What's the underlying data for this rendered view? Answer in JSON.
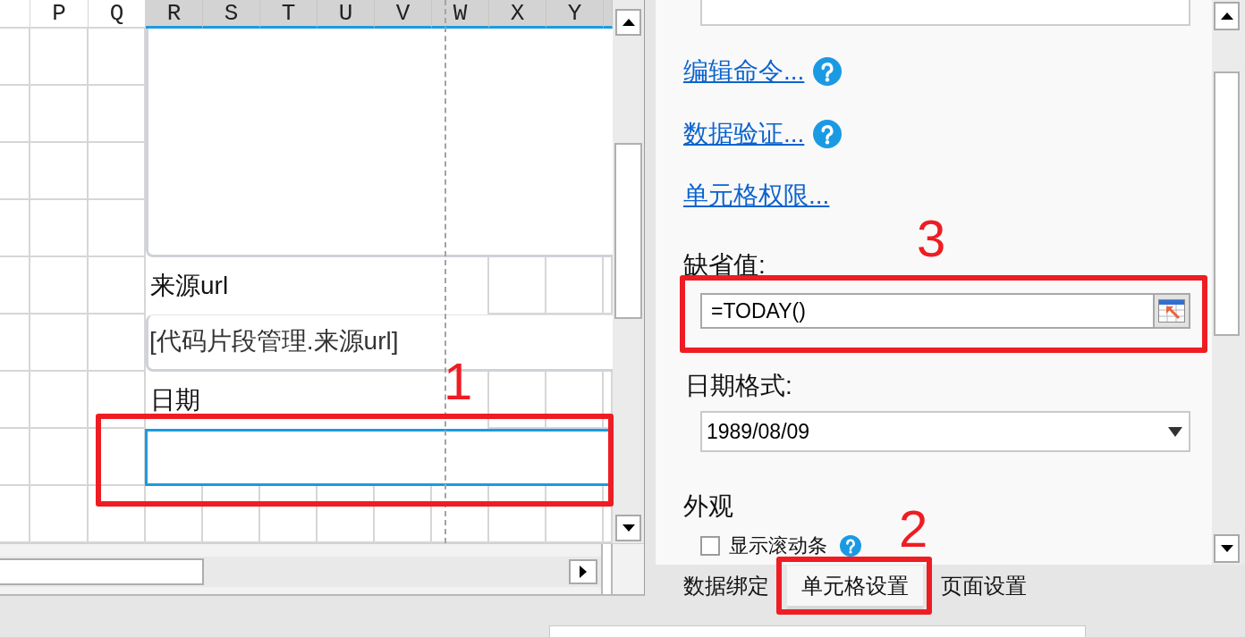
{
  "sheet": {
    "column_headers": [
      {
        "label": "P",
        "selected": false
      },
      {
        "label": "Q",
        "selected": false
      },
      {
        "label": "R",
        "selected": true
      },
      {
        "label": "S",
        "selected": true
      },
      {
        "label": "T",
        "selected": true
      },
      {
        "label": "U",
        "selected": true
      },
      {
        "label": "V",
        "selected": true
      },
      {
        "label": "W",
        "selected": true
      },
      {
        "label": "X",
        "selected": true
      },
      {
        "label": "Y",
        "selected": true
      }
    ],
    "form": [
      {
        "kind": "block"
      },
      {
        "kind": "label",
        "text": "来源url"
      },
      {
        "kind": "bound_field",
        "text": "[代码片段管理.来源url]"
      },
      {
        "kind": "label",
        "text": "日期"
      },
      {
        "kind": "input",
        "selected": true,
        "annotation": "1"
      }
    ]
  },
  "panel": {
    "links": [
      {
        "text": "编辑命令...",
        "help": true
      },
      {
        "text": "数据验证...",
        "help": true
      },
      {
        "text": "单元格权限...",
        "help": false
      }
    ],
    "default_value": {
      "label": "缺省值:",
      "value": "=TODAY()",
      "annotation": "3"
    },
    "date_format": {
      "label": "日期格式:",
      "value": "1989/08/09"
    },
    "appearance": {
      "title": "外观",
      "options": [
        {
          "label": "显示滚动条",
          "checked": false,
          "help": true
        }
      ]
    }
  },
  "tabs": [
    {
      "label": "数据绑定",
      "selected": false
    },
    {
      "label": "单元格设置",
      "selected": true,
      "annotation": "2"
    },
    {
      "label": "页面设置",
      "selected": false
    }
  ]
}
